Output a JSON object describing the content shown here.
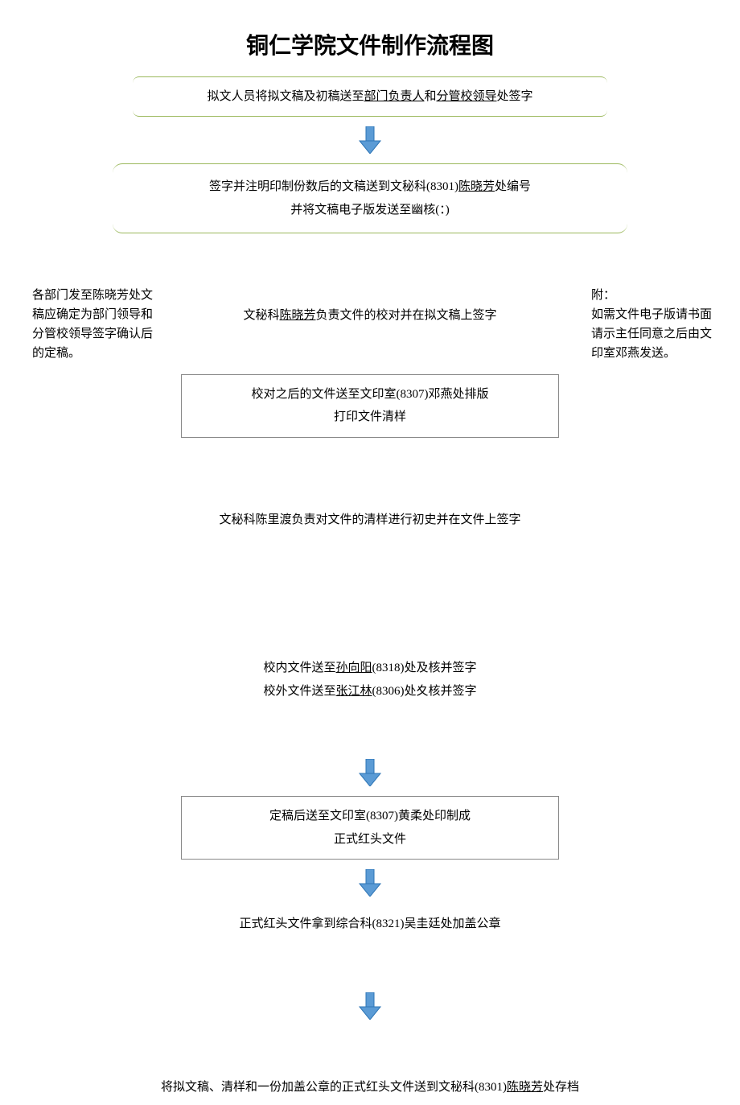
{
  "title": "铜仁学院文件制作流程图",
  "step1": {
    "prefix": "拟文人员将拟文稿及初稿送至",
    "u1": "部门负责人",
    "mid": "和",
    "u2": "分管校领导",
    "suffix": "处签字"
  },
  "step2": {
    "line1a": "签字并注明印制份数后的文稿送到文秘科(8301)",
    "line1u": "陈晓芳",
    "line1b": "处编号",
    "line2": "并将文稿电子版发送至幽核(：)"
  },
  "step3": {
    "a": "文秘科",
    "u": "陈晓芳",
    "b": "负责文件的校对并在拟文稿上签字"
  },
  "step4": {
    "line1": "校对之后的文件送至文印室(8307)邓燕处排版",
    "line2": "打印文件清样"
  },
  "step5": "文秘科陈里渡负责对文件的清样进行初史并在文件上签字",
  "step6": {
    "line1a": "校内文件送至",
    "line1u": "孙向阳",
    "line1b": "(8318)处及核并签字",
    "line2a": "校外文件送至",
    "line2u": "张江林",
    "line2b": "(8306)处夊核并签字"
  },
  "step7": {
    "line1": "定稿后送至文印室(8307)黄柔处印制成",
    "line2": "正式红头文件"
  },
  "step8": "正式红头文件拿到综合科(8321)吴圭廷处加盖公章",
  "step9": {
    "a": "将拟文稿、清样和一份加盖公章的正式红头文件送到文秘科(8301)",
    "u": "陈晓芳",
    "b": "处存档"
  },
  "sideLeft": "各部门发至陈晓芳处文稿应确定为部门领导和分管校领导签字确认后的定稿。",
  "sideRight": {
    "head": "附：",
    "body": "如需文件电子版请书面请示主任同意之后由文印室邓燕发送。"
  }
}
